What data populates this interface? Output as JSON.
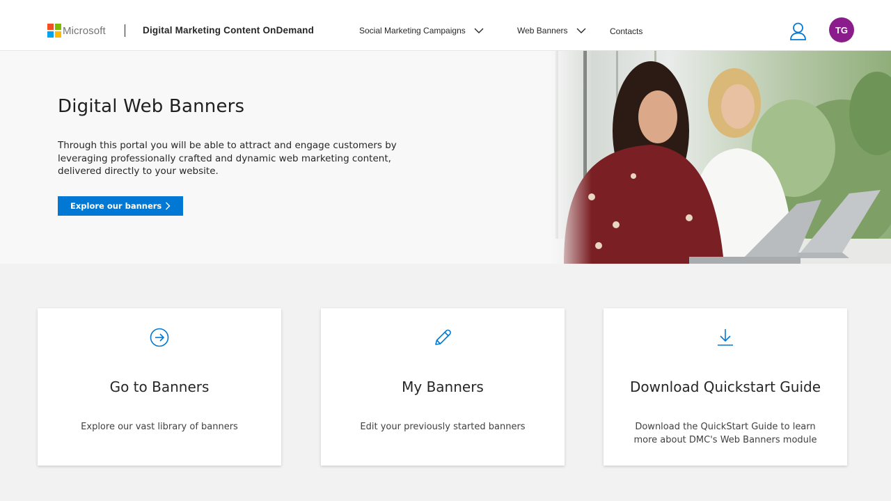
{
  "header": {
    "brand": "Microsoft",
    "site_title": "Digital Marketing Content OnDemand",
    "nav": [
      {
        "label": "Social Marketing Campaigns",
        "has_dropdown": true
      },
      {
        "label": "Web Banners",
        "has_dropdown": true
      },
      {
        "label": "Contacts",
        "has_dropdown": false
      }
    ],
    "user_icon": "person-icon",
    "avatar_initials": "TG"
  },
  "hero": {
    "title": "Digital Web Banners",
    "description": "Through this portal you will be able to attract and engage customers by leveraging professionally crafted and dynamic web marketing content, delivered directly to your website.",
    "button_label": "Explore our banners"
  },
  "cards": [
    {
      "icon": "arrow-circle-right-icon",
      "title": "Go to Banners",
      "description": "Explore our vast library of banners"
    },
    {
      "icon": "pencil-icon",
      "title": "My Banners",
      "description": "Edit your previously started banners"
    },
    {
      "icon": "download-icon",
      "title": "Download Quickstart Guide",
      "description": "Download the QuickStart Guide to learn more about DMC's Web Banners module"
    }
  ],
  "colors": {
    "accent": "#0078d4",
    "avatar": "#8a1c8c",
    "page_background": "#f2f2f2"
  }
}
